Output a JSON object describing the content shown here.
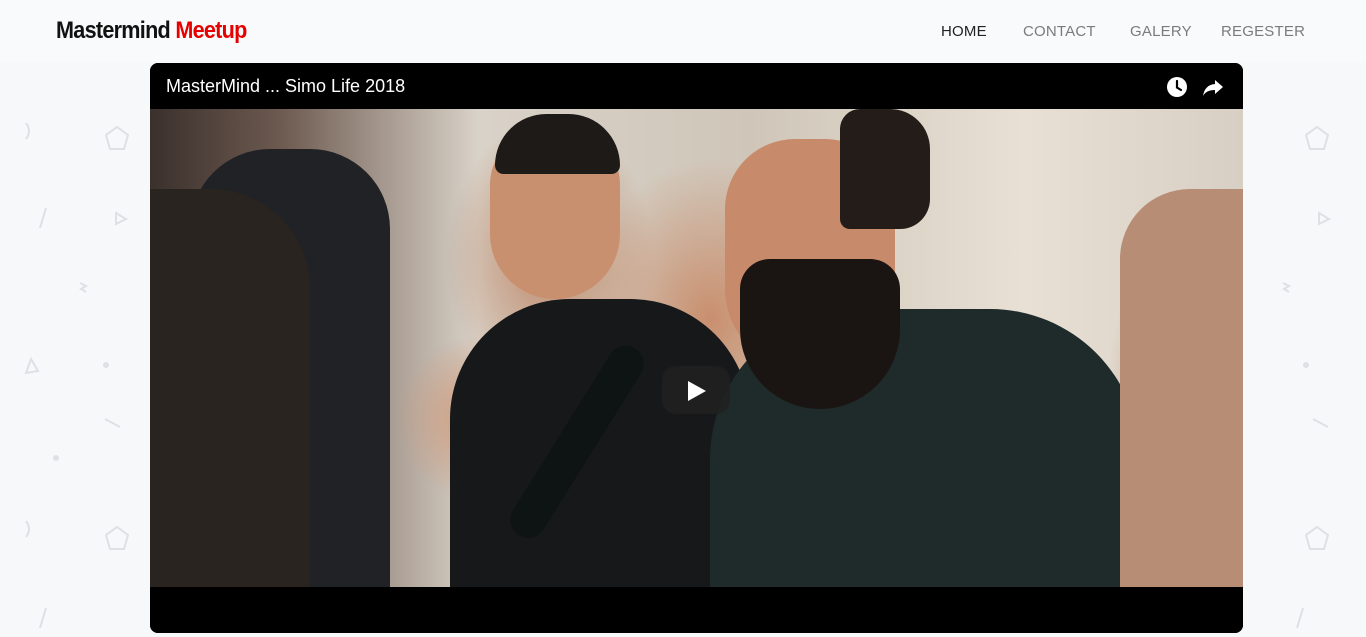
{
  "header": {
    "logo_part1": "Mastermind",
    "logo_part2": "Meetup",
    "nav": [
      {
        "label": "HOME",
        "active": true
      },
      {
        "label": "CONTACT",
        "active": false
      },
      {
        "label": "GALERY",
        "active": false
      },
      {
        "label": "REGESTER",
        "active": false
      }
    ]
  },
  "video": {
    "title": "MasterMind ... Simo Life 2018",
    "icons": [
      "watch-later-icon",
      "share-icon",
      "play-icon"
    ]
  },
  "colors": {
    "logo_accent": "#e60000",
    "background": "#f7f8fa",
    "nav_active": "#222222",
    "nav_inactive": "#7b7b7b"
  }
}
